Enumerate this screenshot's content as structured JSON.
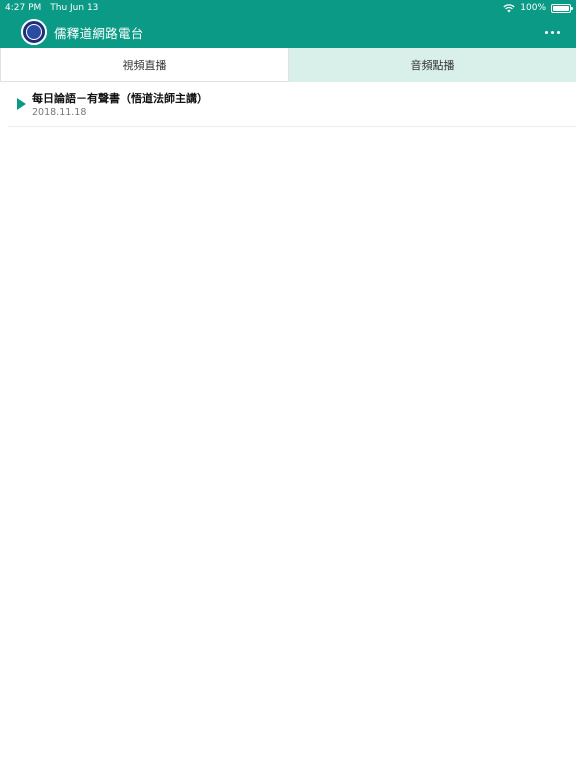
{
  "status_bar": {
    "time": "4:27 PM",
    "date": "Thu Jun 13",
    "battery": "100%"
  },
  "nav": {
    "title": "儒釋道網路電台"
  },
  "tabs": [
    {
      "label": "視頻直播",
      "active": true
    },
    {
      "label": "音頻點播",
      "active": false
    }
  ],
  "list": {
    "items": [
      {
        "title": "每日論語－有聲書（悟道法師主講）",
        "date": "2018.11.18"
      }
    ]
  },
  "colors": {
    "accent": "#0b9a86",
    "inactive_tab": "#d8efea"
  }
}
